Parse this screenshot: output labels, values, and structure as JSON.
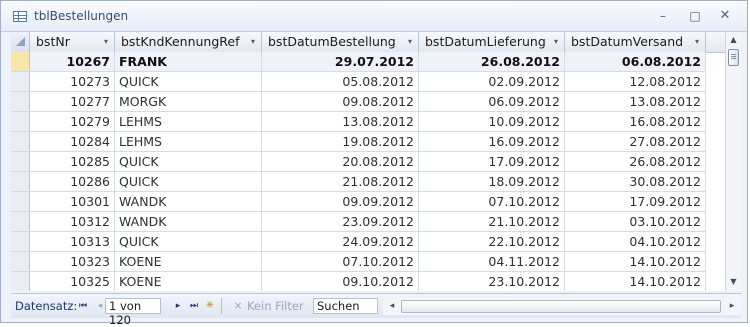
{
  "window": {
    "title": "tblBestellungen",
    "minimize_glyph": "–",
    "maximize_glyph": "□",
    "close_glyph": "✕"
  },
  "columns": [
    {
      "label": "bstNr"
    },
    {
      "label": "bstKndKennungRef"
    },
    {
      "label": "bstDatumBestellung"
    },
    {
      "label": "bstDatumLieferung"
    },
    {
      "label": "bstDatumVersand"
    }
  ],
  "sort_arrow": "▾",
  "rows": [
    {
      "bstNr": "10267",
      "kunde": "FRANK",
      "bestellung": "29.07.2012",
      "lieferung": "26.08.2012",
      "versand": "06.08.2012",
      "selected": true
    },
    {
      "bstNr": "10273",
      "kunde": "QUICK",
      "bestellung": "05.08.2012",
      "lieferung": "02.09.2012",
      "versand": "12.08.2012"
    },
    {
      "bstNr": "10277",
      "kunde": "MORGK",
      "bestellung": "09.08.2012",
      "lieferung": "06.09.2012",
      "versand": "13.08.2012"
    },
    {
      "bstNr": "10279",
      "kunde": "LEHMS",
      "bestellung": "13.08.2012",
      "lieferung": "10.09.2012",
      "versand": "16.08.2012"
    },
    {
      "bstNr": "10284",
      "kunde": "LEHMS",
      "bestellung": "19.08.2012",
      "lieferung": "16.09.2012",
      "versand": "27.08.2012"
    },
    {
      "bstNr": "10285",
      "kunde": "QUICK",
      "bestellung": "20.08.2012",
      "lieferung": "17.09.2012",
      "versand": "26.08.2012"
    },
    {
      "bstNr": "10286",
      "kunde": "QUICK",
      "bestellung": "21.08.2012",
      "lieferung": "18.09.2012",
      "versand": "30.08.2012"
    },
    {
      "bstNr": "10301",
      "kunde": "WANDK",
      "bestellung": "09.09.2012",
      "lieferung": "07.10.2012",
      "versand": "17.09.2012"
    },
    {
      "bstNr": "10312",
      "kunde": "WANDK",
      "bestellung": "23.09.2012",
      "lieferung": "21.10.2012",
      "versand": "03.10.2012"
    },
    {
      "bstNr": "10313",
      "kunde": "QUICK",
      "bestellung": "24.09.2012",
      "lieferung": "22.10.2012",
      "versand": "04.10.2012"
    },
    {
      "bstNr": "10323",
      "kunde": "KOENE",
      "bestellung": "07.10.2012",
      "lieferung": "04.11.2012",
      "versand": "14.10.2012"
    },
    {
      "bstNr": "10325",
      "kunde": "KOENE",
      "bestellung": "09.10.2012",
      "lieferung": "23.10.2012",
      "versand": "14.10.2012"
    }
  ],
  "navigation": {
    "label": "Datensatz:",
    "position": "1 von 120",
    "first_glyph": "⏮",
    "prev_glyph": "◂",
    "next_glyph": "▸",
    "last_glyph": "⏭",
    "new_glyph": "✳",
    "filter_icon": "funnel-crossed-icon",
    "filter_glyph": "⨯",
    "filter_label": "Kein Filter",
    "search_placeholder": "Suchen"
  },
  "scrollbar": {
    "up_glyph": "▲",
    "down_glyph": "▼",
    "left_glyph": "◂",
    "right_glyph": "▸"
  },
  "colors": {
    "selected_row_selector": "#f8e7a8",
    "nav_text": "#1f3a68"
  }
}
